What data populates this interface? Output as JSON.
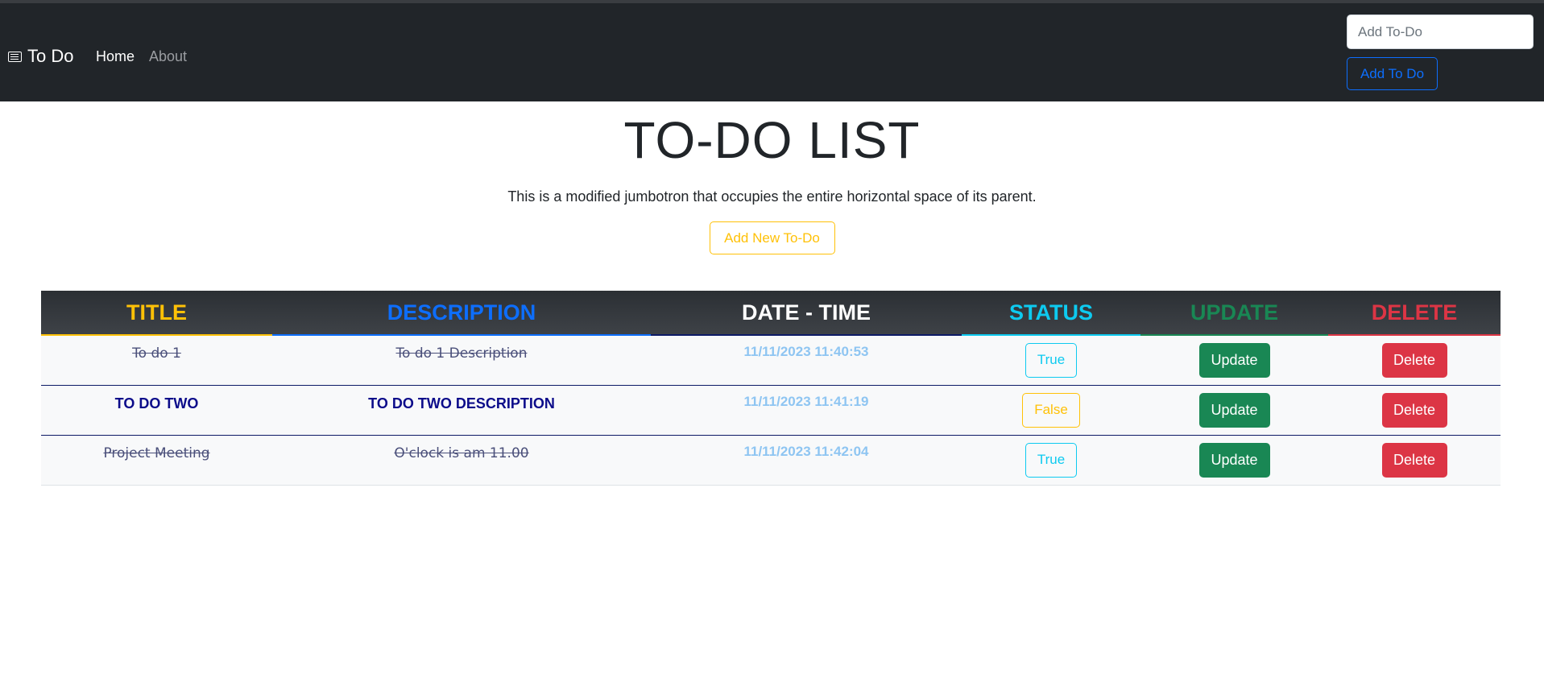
{
  "navbar": {
    "brand": "To Do",
    "brand_icon": "card-text-icon",
    "links": [
      {
        "label": "Home",
        "active": true
      },
      {
        "label": "About",
        "active": false
      }
    ],
    "input_placeholder": "Add To-Do",
    "add_button": "Add To Do"
  },
  "jumbotron": {
    "title": "TO-DO LIST",
    "lead": "This is a modified jumbotron that occupies the entire horizontal space of its parent.",
    "button": "Add New To-Do"
  },
  "table": {
    "headers": [
      {
        "label": "TITLE",
        "color": "#ffc107",
        "underline": "#ffc107"
      },
      {
        "label": "DESCRIPTION",
        "color": "#0d6efd",
        "underline": "#0d6efd"
      },
      {
        "label": "DATE - TIME",
        "color": "#ffffff",
        "underline": "#0d1a66"
      },
      {
        "label": "STATUS",
        "color": "#0dcaf0",
        "underline": "#0dcaf0"
      },
      {
        "label": "UPDATE",
        "color": "#198754",
        "underline": "#198754"
      },
      {
        "label": "DELETE",
        "color": "#dc3545",
        "underline": "#dc3545"
      }
    ],
    "rows": [
      {
        "title": "To do 1",
        "description": "To do 1 Description",
        "datetime": "11/11/2023 11:40:53",
        "status": "True",
        "update": "Update",
        "delete": "Delete"
      },
      {
        "title": "TO DO TWO",
        "description": "TO DO TWO DESCRIPTION",
        "datetime": "11/11/2023 11:41:19",
        "status": "False",
        "update": "Update",
        "delete": "Delete"
      },
      {
        "title": "Project Meeting",
        "description": "O'clock is am 11.00",
        "datetime": "11/11/2023 11:42:04",
        "status": "True",
        "update": "Update",
        "delete": "Delete"
      }
    ]
  }
}
